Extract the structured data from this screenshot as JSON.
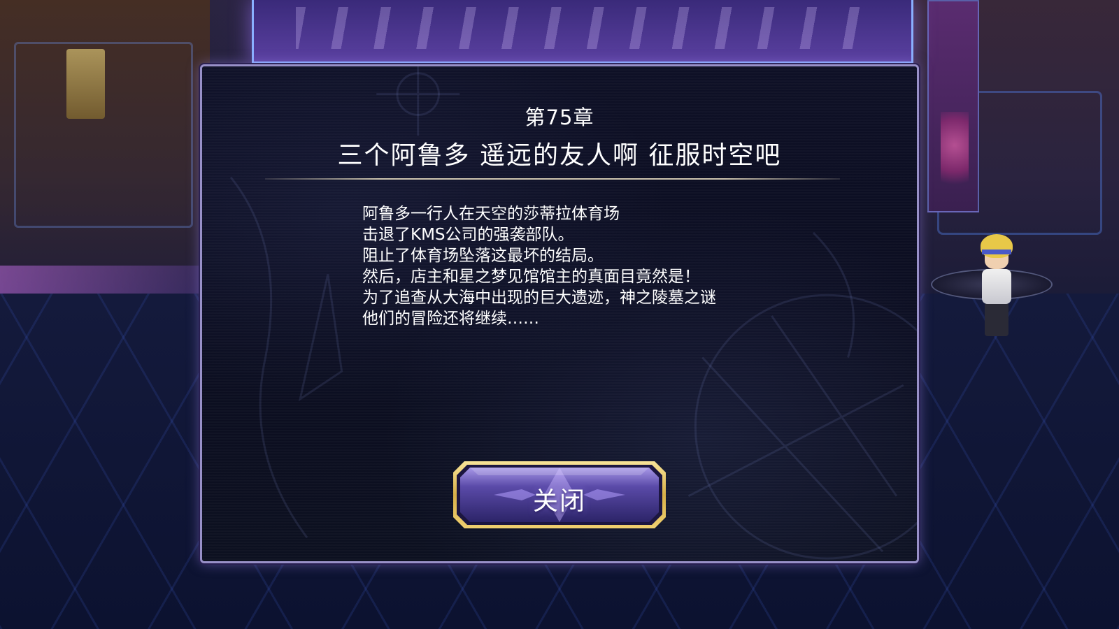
{
  "dialog": {
    "chapter_label": "第75章",
    "chapter_title": "三个阿鲁多 遥远的友人啊 征服时空吧",
    "story_lines": [
      "阿鲁多一行人在天空的莎蒂拉体育场",
      "击退了KMS公司的强袭部队。",
      "阻止了体育场坠落这最坏的结局。",
      "然后，店主和星之梦见馆馆主的真面目竟然是！",
      "为了追查从大海中出现的巨大遗迹，神之陵墓之谜",
      "他们的冒险还将继续……"
    ],
    "close_label": "关闭"
  },
  "colors": {
    "dialog_border": "#9890c8",
    "button_gold": "#e8c860",
    "button_purple": "#6a58b8",
    "text": "#ffffff"
  }
}
